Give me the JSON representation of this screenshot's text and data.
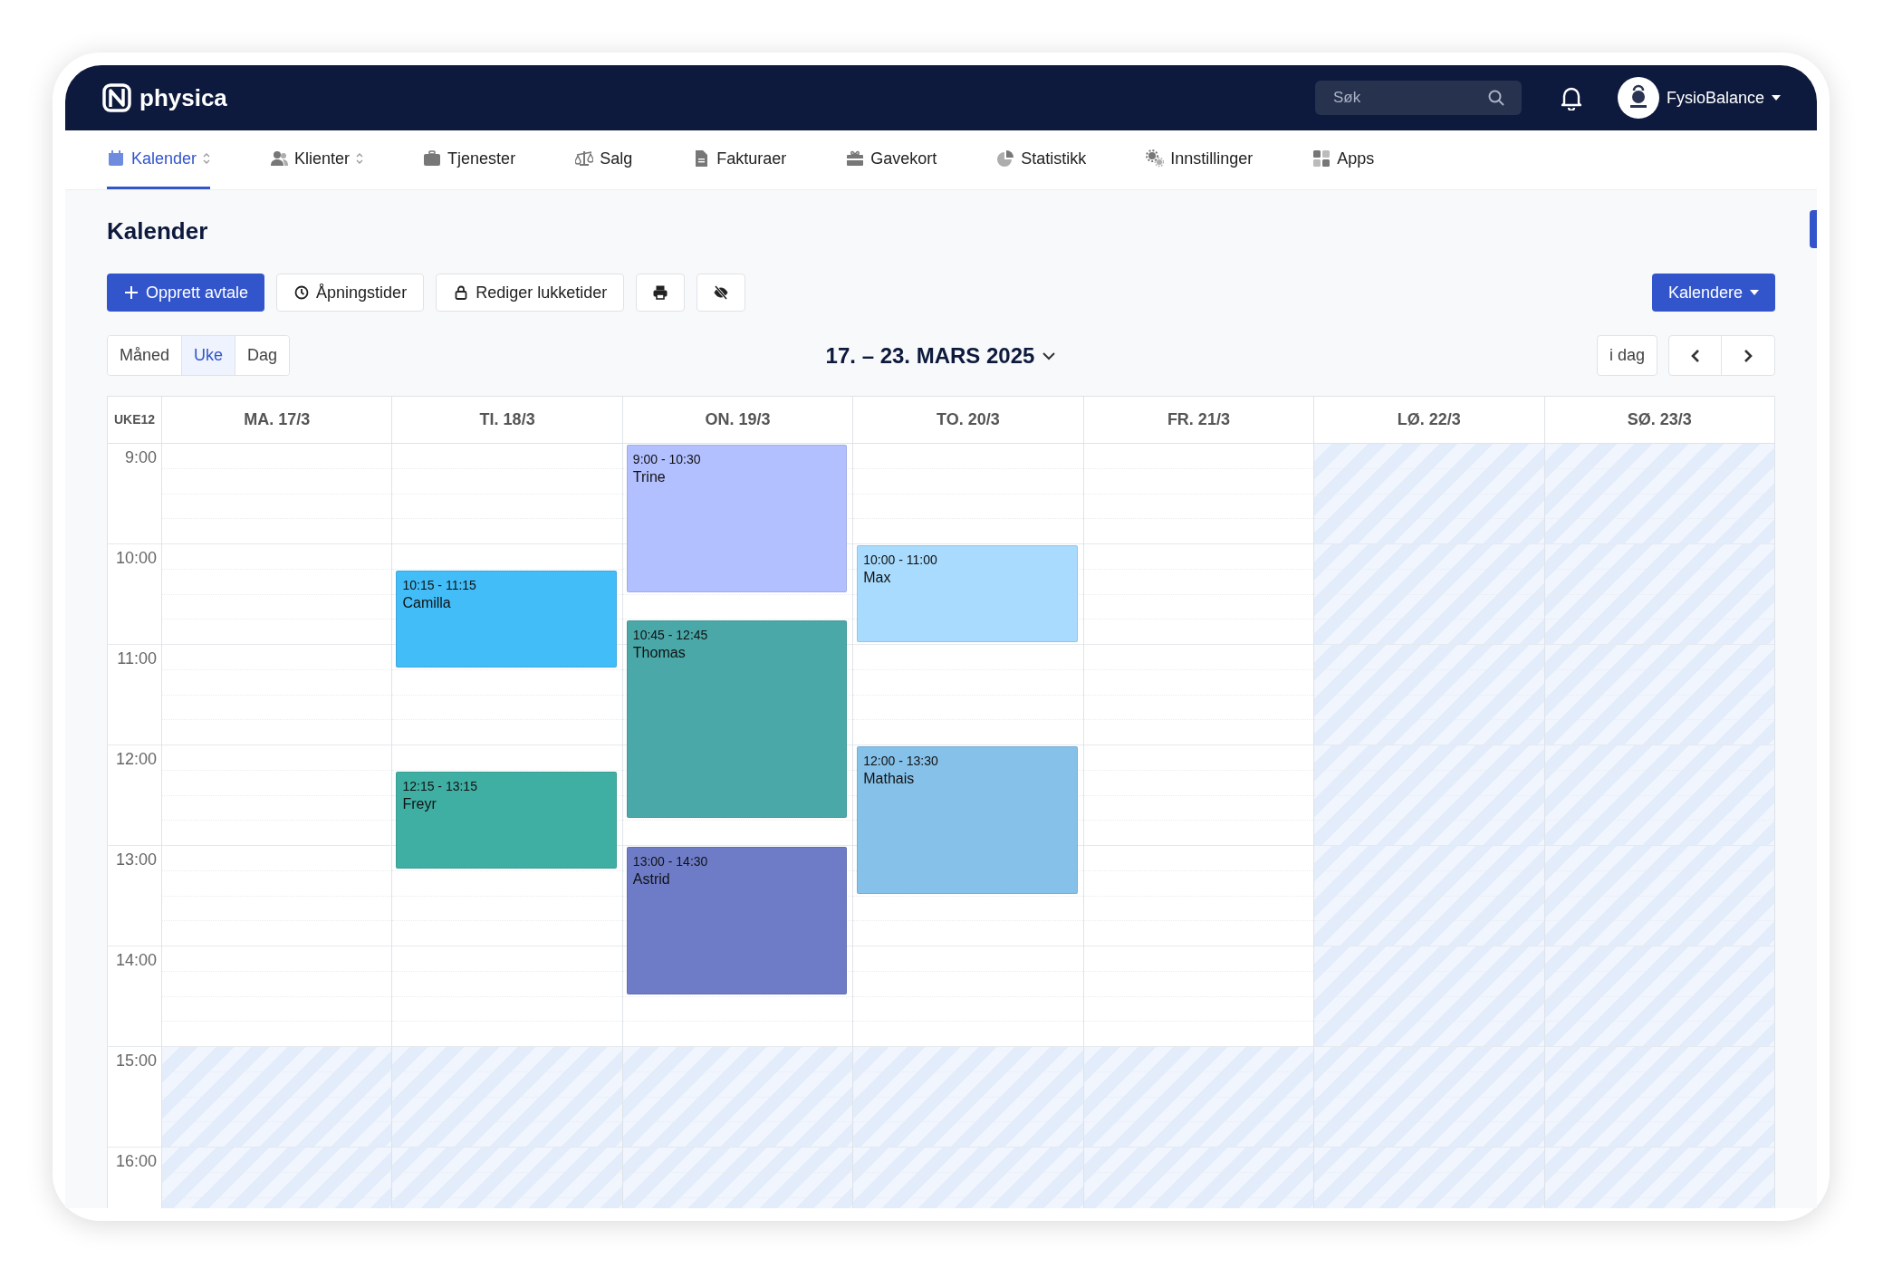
{
  "brand": {
    "name": "physica"
  },
  "search": {
    "placeholder": "Søk"
  },
  "account": {
    "name": "FysioBalance"
  },
  "nav": [
    {
      "label": "Kalender",
      "dropdown": true,
      "selected": true
    },
    {
      "label": "Klienter",
      "dropdown": true,
      "selected": false
    },
    {
      "label": "Tjenester",
      "dropdown": false,
      "selected": false
    },
    {
      "label": "Salg",
      "dropdown": false,
      "selected": false
    },
    {
      "label": "Fakturaer",
      "dropdown": false,
      "selected": false
    },
    {
      "label": "Gavekort",
      "dropdown": false,
      "selected": false
    },
    {
      "label": "Statistikk",
      "dropdown": false,
      "selected": false
    },
    {
      "label": "Innstillinger",
      "dropdown": false,
      "selected": false
    },
    {
      "label": "Apps",
      "dropdown": false,
      "selected": false
    }
  ],
  "page_title": "Kalender",
  "toolbar": [
    {
      "kind": "primary",
      "label": "Opprett avtale"
    },
    {
      "kind": "outline",
      "label": "Åpningstider"
    },
    {
      "kind": "outline",
      "label": "Rediger lukketider"
    },
    {
      "kind": "icon"
    },
    {
      "kind": "icon"
    }
  ],
  "calendars_button": "Kalendere",
  "views": [
    {
      "label": "Måned",
      "selected": false
    },
    {
      "label": "Uke",
      "selected": true
    },
    {
      "label": "Dag",
      "selected": false
    }
  ],
  "range_title": "17. – 23. MARS 2025",
  "today_button": "i dag",
  "week_label": "UKE12",
  "hours": [
    {
      "label": "9:00",
      "closed": false
    },
    {
      "label": "10:00",
      "closed": false
    },
    {
      "label": "11:00",
      "closed": false
    },
    {
      "label": "12:00",
      "closed": false
    },
    {
      "label": "13:00",
      "closed": false
    },
    {
      "label": "14:00",
      "closed": false
    },
    {
      "label": "15:00",
      "closed": true
    },
    {
      "label": "16:00",
      "closed": true
    }
  ],
  "days": [
    {
      "label": "MA. 17/3",
      "closed": false
    },
    {
      "label": "TI. 18/3",
      "closed": false,
      "events": [
        {
          "time": "10:15 - 11:15",
          "name": "Camilla",
          "color": "#42bdf7"
        },
        {
          "time": "12:15 - 13:15",
          "name": "Freyr",
          "color": "#40afa3"
        }
      ]
    },
    {
      "label": "ON. 19/3",
      "closed": false,
      "events": [
        {
          "time": "9:00 - 10:30",
          "name": "Trine",
          "color": "#b3c0ff"
        },
        {
          "time": "10:45 - 12:45",
          "name": "Thomas",
          "color": "#4aa8a9"
        },
        {
          "time": "13:00 - 14:30",
          "name": "Astrid",
          "color": "#6e7cc8"
        }
      ]
    },
    {
      "label": "TO. 20/3",
      "closed": false,
      "events": [
        {
          "time": "10:00 - 11:00",
          "name": "Max",
          "color": "#a8dbfd"
        },
        {
          "time": "12:00 - 13:30",
          "name": "Mathais",
          "color": "#86c1e9"
        }
      ]
    },
    {
      "label": "FR. 21/3",
      "closed": false
    },
    {
      "label": "LØ. 22/3",
      "closed": true
    },
    {
      "label": "SØ. 23/3",
      "closed": true
    }
  ]
}
